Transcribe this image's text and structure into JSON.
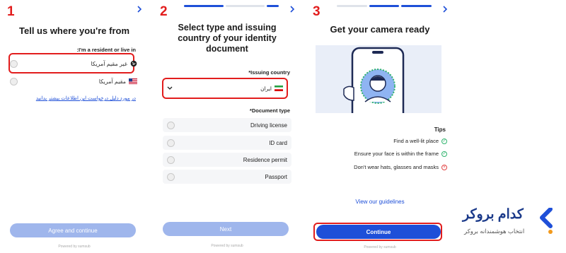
{
  "panel1": {
    "step": "1",
    "title": "Tell us where you're from",
    "question": ":I'm a resident or live in",
    "options": [
      {
        "label": "غیر مقیم آمریکا"
      },
      {
        "label": "مقیم آمریکا"
      }
    ],
    "link": "در مورد دلیل درخواست این اطلاعات بیشتر بدانید",
    "button": "Agree and continue",
    "powered": "Powered by  sumsub"
  },
  "panel2": {
    "step": "2",
    "title_lines": [
      "Select type and issuing",
      "country of your identity",
      "document"
    ],
    "issuing_label": "*Issuing country",
    "country_value": "ایران",
    "doc_type_label": "*Document type",
    "doc_types": [
      "Driving license",
      "ID card",
      "Residence permit",
      "Passport"
    ],
    "button": "Next",
    "powered": "Powered by  sumsub"
  },
  "panel3": {
    "step": "3",
    "title": "Get your camera ready",
    "tips_title": "Tips",
    "tips": [
      {
        "text": "Find a well-lit place",
        "ok": true
      },
      {
        "text": "Ensure your face is within the frame",
        "ok": true
      },
      {
        "text": "Don't wear hats, glasses and masks",
        "ok": false
      }
    ],
    "guidelines": "View our guidelines",
    "button": "Continue",
    "powered": "Powered by  sumsub"
  },
  "brand": {
    "name": "کدام بروکر",
    "tagline": "انتخاب هوشمندانه بروکر"
  },
  "colors": {
    "step_red": "#e21d1d",
    "primary_blue": "#1e4fd8",
    "disabled_blue": "#9fb6ec"
  }
}
